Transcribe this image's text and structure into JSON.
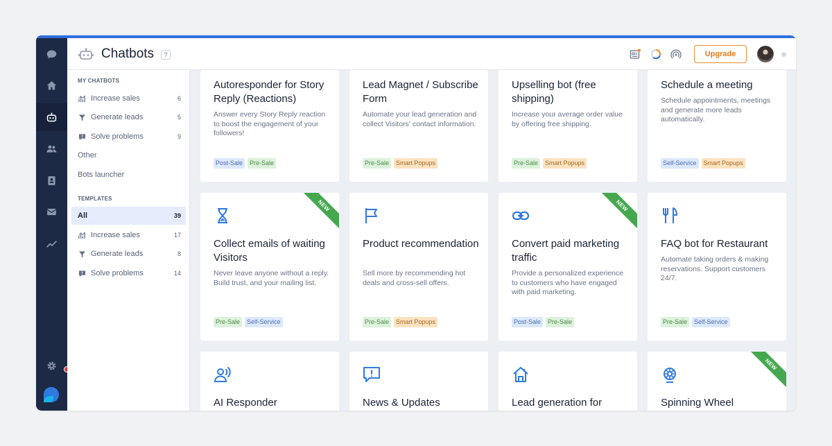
{
  "app": {
    "title": "Chatbots",
    "help": "?"
  },
  "header": {
    "upgrade_label": "Upgrade"
  },
  "sidebar": {
    "my_chatbots_title": "MY CHATBOTS",
    "my_chatbots": [
      {
        "label": "Increase sales",
        "count": "6",
        "icon": "chart-icon"
      },
      {
        "label": "Generate leads",
        "count": "5",
        "icon": "funnel-icon"
      },
      {
        "label": "Solve problems",
        "count": "9",
        "icon": "alert-icon"
      }
    ],
    "other_label": "Other",
    "bots_launcher_label": "Bots launcher",
    "templates_title": "TEMPLATES",
    "templates_all": {
      "label": "All",
      "count": "39"
    },
    "templates": [
      {
        "label": "Increase sales",
        "count": "17",
        "icon": "chart-icon"
      },
      {
        "label": "Generate leads",
        "count": "8",
        "icon": "funnel-icon"
      },
      {
        "label": "Solve problems",
        "count": "14",
        "icon": "alert-icon"
      }
    ]
  },
  "cards": [
    {
      "title": "Autoresponder for Story Reply (Reactions)",
      "desc": "Answer every Story Reply reaction to boost the engagement of your followers!",
      "tags": [
        "Post-Sale",
        "Pre-Sale"
      ]
    },
    {
      "title": "Lead Magnet / Subscribe Form",
      "desc": "Automate your lead generation and collect Visitors' contact information.",
      "tags": [
        "Pre-Sale",
        "Smart Popups"
      ]
    },
    {
      "title": "Upselling bot (free shipping)",
      "desc": "Increase your average order value by offering free shipping.",
      "tags": [
        "Pre-Sale",
        "Smart Popups"
      ]
    },
    {
      "title": "Schedule a meeting",
      "desc": "Schedule appointments, meetings and generate more leads automatically.",
      "tags": [
        "Self-Service",
        "Smart Popups"
      ]
    },
    {
      "title": "Collect emails of waiting Visitors",
      "desc": "Never leave anyone without a reply. Build trust, and your mailing list.",
      "tags": [
        "Pre-Sale",
        "Self-Service"
      ],
      "badge": "NEW",
      "icon": "hourglass-icon"
    },
    {
      "title": "Product recommendation",
      "desc": "Sell more by recommending hot deals and cross-sell offers.",
      "tags": [
        "Pre-Sale",
        "Smart Popups"
      ],
      "icon": "flag-icon"
    },
    {
      "title": "Convert paid marketing traffic",
      "desc": "Provide a personalized experience to customers who have engaged with paid marketing.",
      "tags": [
        "Post-Sale",
        "Pre-Sale"
      ],
      "badge": "NEW",
      "icon": "link-icon"
    },
    {
      "title": "FAQ bot for Restaurant",
      "desc": "Automate taking orders & making reservations. Support customers 24/7.",
      "tags": [
        "Pre-Sale",
        "Self-Service"
      ],
      "icon": "fork-knife-icon"
    },
    {
      "title": "AI Responder",
      "icon": "voice-user-icon"
    },
    {
      "title": "News & Updates",
      "icon": "message-alert-icon"
    },
    {
      "title": "Lead generation for",
      "icon": "house-icon"
    },
    {
      "title": "Spinning Wheel",
      "badge": "NEW",
      "icon": "wheel-icon"
    }
  ],
  "colors": {
    "accent": "#2f6fe0",
    "rail": "#1d2a45",
    "upgrade": "#f08a2c",
    "new_ribbon": "#45a84f",
    "icon_blue": "#2f7ae0"
  }
}
